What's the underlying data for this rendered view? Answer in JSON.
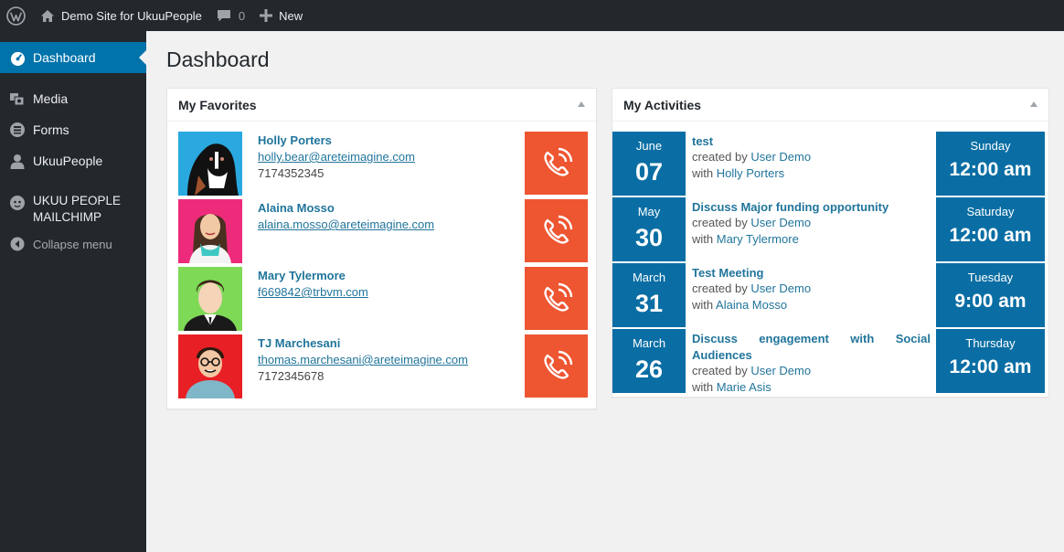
{
  "adminbar": {
    "site_name": "Demo Site for UkuuPeople",
    "comments_count": "0",
    "new_label": "New"
  },
  "sidebar": {
    "items": [
      {
        "label": "Dashboard"
      },
      {
        "label": "Media"
      },
      {
        "label": "Forms"
      },
      {
        "label": "UkuuPeople"
      },
      {
        "label": "UKUU PEOPLE MAILCHIMP"
      },
      {
        "label": "Collapse menu"
      }
    ]
  },
  "page_title": "Dashboard",
  "favorites": {
    "title": "My Favorites",
    "items": [
      {
        "name": "Holly Porters",
        "email": "holly.bear@areteimagine.com",
        "phone": "7174352345",
        "avatar_bg": "#29a9df"
      },
      {
        "name": "Alaina Mosso",
        "email": "alaina.mosso@areteimagine.com",
        "phone": "",
        "avatar_bg": "#ee2a7b"
      },
      {
        "name": "Mary Tylermore",
        "email": "f669842@trbvm.com",
        "phone": "",
        "avatar_bg": "#7ed957"
      },
      {
        "name": "TJ Marchesani",
        "email": "thomas.marchesani@areteimagine.com",
        "phone": "7172345678",
        "avatar_bg": "#e81f25"
      }
    ]
  },
  "activities": {
    "title": "My Activities",
    "created_by_label": "created by",
    "with_label": "with",
    "items": [
      {
        "month": "June",
        "day": "07",
        "title": "test",
        "creator": "User Demo",
        "with": "Holly Porters",
        "weekday": "Sunday",
        "time": "12:00 am"
      },
      {
        "month": "May",
        "day": "30",
        "title": "Discuss Major funding opportunity",
        "creator": "User Demo",
        "with": "Mary Tylermore",
        "weekday": "Saturday",
        "time": "12:00 am"
      },
      {
        "month": "March",
        "day": "31",
        "title": "Test Meeting",
        "creator": "User Demo",
        "with": "Alaina Mosso",
        "weekday": "Tuesday",
        "time": "9:00 am"
      },
      {
        "month": "March",
        "day": "26",
        "title": "Discuss engagement with Social Audiences",
        "creator": "User Demo",
        "with": "Marie Asis",
        "weekday": "Thursday",
        "time": "12:00 am"
      }
    ]
  },
  "colors": {
    "accent": "#0073aa",
    "call_button": "#ee5531",
    "date_block": "#0a6ea4",
    "adminbar": "#23282d"
  }
}
